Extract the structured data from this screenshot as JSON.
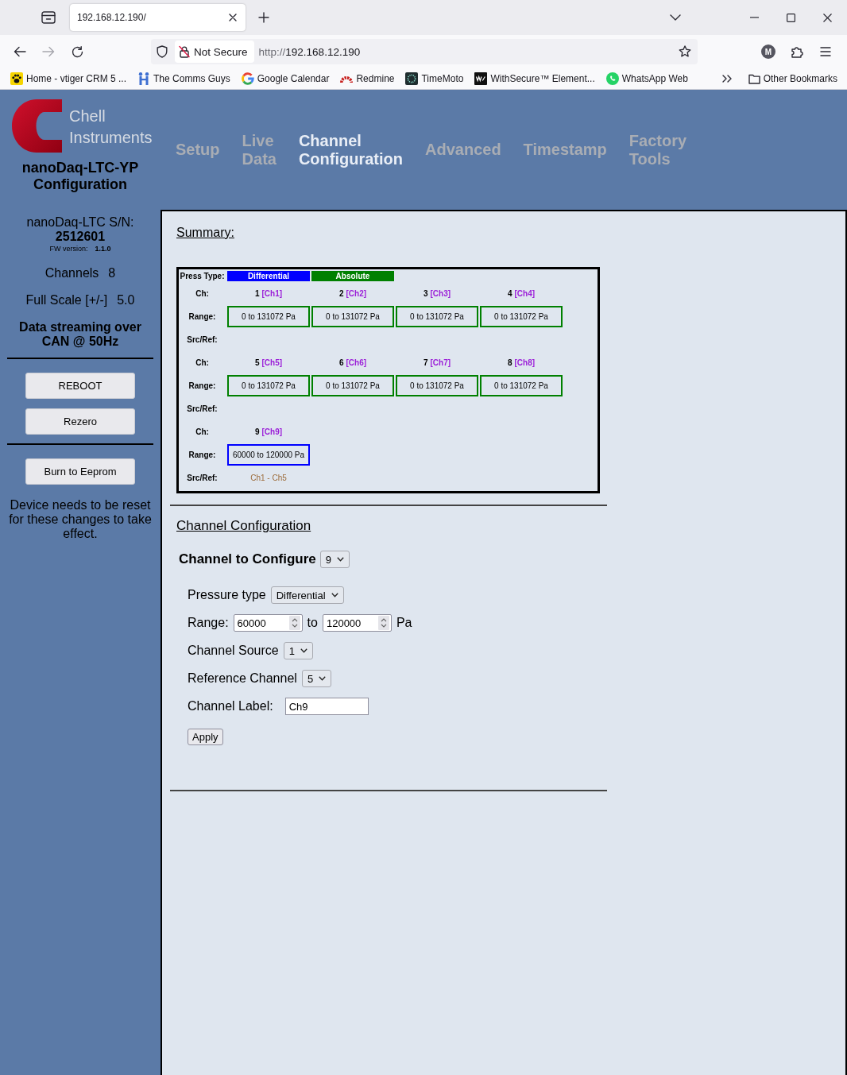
{
  "browser": {
    "tab": {
      "title": "192.168.12.190/"
    },
    "address": {
      "security": "Not Secure",
      "scheme": "http://",
      "host": "192.168.12.190"
    },
    "profile": "M",
    "bookmarks": [
      {
        "kind": "paw",
        "label": "Home - vtiger CRM 5 ..."
      },
      {
        "kind": "figures",
        "label": "The Comms Guys"
      },
      {
        "kind": "g",
        "label": "Google Calendar"
      },
      {
        "kind": "arc",
        "label": "Redmine"
      },
      {
        "kind": "ring",
        "label": "TimeMoto"
      },
      {
        "kind": "tile",
        "label": "WithSecure™ Element..."
      },
      {
        "kind": "bubble",
        "label": "WhatsApp Web"
      }
    ],
    "other_bookmarks": "Other Bookmarks"
  },
  "header": {
    "brand": "Chell Instruments",
    "device_title": "nanoDaq-LTC-YP Configuration"
  },
  "nav": [
    {
      "label": "Setup",
      "selected": false
    },
    {
      "label": "Live Data",
      "selected": false
    },
    {
      "label": "Channel Configuration",
      "selected": true
    },
    {
      "label": "Advanced",
      "selected": false
    },
    {
      "label": "Timestamp",
      "selected": false
    },
    {
      "label": "Factory Tools",
      "selected": false
    }
  ],
  "sidebar": {
    "serial_label": "nanoDaq-LTC S/N:",
    "serial": "2512601",
    "fw_label": "FW version:",
    "fw_version": "1.1.0",
    "stats": [
      {
        "label": "Channels",
        "value": "8"
      },
      {
        "label": "Full Scale [+/-]",
        "value": "5.0"
      }
    ],
    "streaming": "Data streaming over CAN @ 50Hz",
    "button_groups": [
      [
        "REBOOT",
        "Rezero"
      ],
      [
        "Burn to Eeprom"
      ]
    ],
    "note": "Device needs to be reset for these changes to take effect."
  },
  "summary": {
    "title": "Summary:",
    "press_type_label": "Press Type:",
    "press_types": [
      {
        "label": "Differential",
        "color": "#0000ff"
      },
      {
        "label": "Absolute",
        "color": "#008000"
      }
    ],
    "groups": [
      {
        "ch_label": "Ch:",
        "range_label": "Range:",
        "src_ref_label": "Src/Ref:",
        "channels": [
          {
            "number": "1",
            "tag": "[Ch1]",
            "range": "0 to 131072 Pa",
            "color": "#008000"
          },
          {
            "number": "2",
            "tag": "[Ch2]",
            "range": "0 to 131072 Pa",
            "color": "#008000"
          },
          {
            "number": "3",
            "tag": "[Ch3]",
            "range": "0 to 131072 Pa",
            "color": "#008000"
          },
          {
            "number": "4",
            "tag": "[Ch4]",
            "range": "0 to 131072 Pa",
            "color": "#008000"
          }
        ]
      },
      {
        "ch_label": "Ch:",
        "range_label": "Range:",
        "src_ref_label": "Src/Ref:",
        "channels": [
          {
            "number": "5",
            "tag": "[Ch5]",
            "range": "0 to 131072 Pa",
            "color": "#008000"
          },
          {
            "number": "6",
            "tag": "[Ch6]",
            "range": "0 to 131072 Pa",
            "color": "#008000"
          },
          {
            "number": "7",
            "tag": "[Ch7]",
            "range": "0 to 131072 Pa",
            "color": "#008000"
          },
          {
            "number": "8",
            "tag": "[Ch8]",
            "range": "0 to 131072 Pa",
            "color": "#008000"
          }
        ]
      },
      {
        "ch_label": "Ch:",
        "range_label": "Range:",
        "src_ref_label": "Src/Ref:",
        "channels": [
          {
            "number": "9",
            "tag": "[Ch9]",
            "range": "60000 to 120000 Pa",
            "color": "#0000ff",
            "src_ref": "Ch1 - Ch5"
          }
        ]
      }
    ]
  },
  "channel_config": {
    "title": "Channel Configuration",
    "selector": {
      "label": "Channel to Configure",
      "value": "9"
    },
    "fields": [
      {
        "kind": "select",
        "label": "Pressure type",
        "value": "Differential"
      },
      {
        "kind": "range",
        "label": "Range:",
        "from": "60000",
        "joiner": "to",
        "to": "120000",
        "unit": "Pa"
      },
      {
        "kind": "select",
        "label": "Channel Source",
        "value": "1"
      },
      {
        "kind": "select",
        "label": "Reference Channel",
        "value": "5"
      },
      {
        "kind": "text",
        "label": "Channel Label:",
        "value": "Ch9"
      }
    ],
    "apply": "Apply"
  }
}
